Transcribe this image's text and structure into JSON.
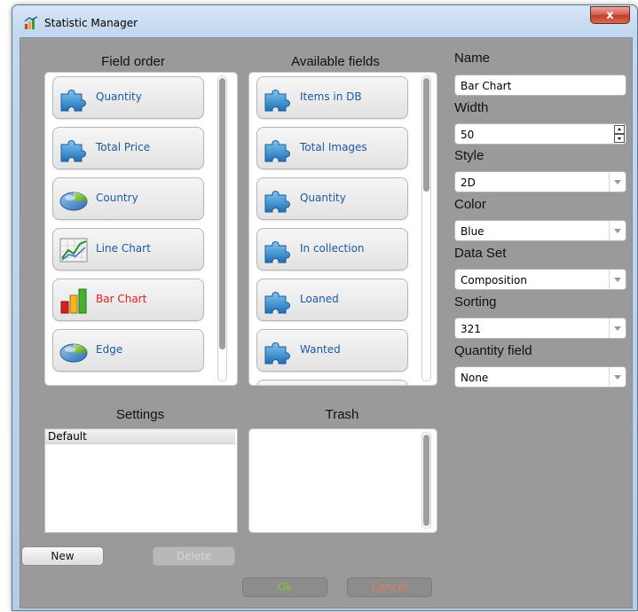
{
  "window": {
    "title": "Statistic Manager",
    "close_glyph": "x",
    "icon": "statistic-manager-app-icon"
  },
  "field_order": {
    "heading": "Field order",
    "items": [
      {
        "label": "Quantity",
        "icon": "puzzle-piece-icon"
      },
      {
        "label": "Total Price",
        "icon": "puzzle-piece-icon"
      },
      {
        "label": "Country",
        "icon": "pie-chart-icon"
      },
      {
        "label": "Line Chart",
        "icon": "line-chart-icon"
      },
      {
        "label": "Bar Chart",
        "icon": "bar-chart-icon",
        "selected": true
      },
      {
        "label": "Edge",
        "icon": "pie-chart-icon"
      }
    ]
  },
  "available_fields": {
    "heading": "Available fields",
    "items": [
      {
        "label": "Items in DB",
        "icon": "puzzle-piece-icon"
      },
      {
        "label": "Total Images",
        "icon": "puzzle-piece-icon"
      },
      {
        "label": "Quantity",
        "icon": "puzzle-piece-icon"
      },
      {
        "label": "In collection",
        "icon": "puzzle-piece-icon"
      },
      {
        "label": "Loaned",
        "icon": "puzzle-piece-icon"
      },
      {
        "label": "Wanted",
        "icon": "puzzle-piece-icon"
      }
    ]
  },
  "properties": {
    "name_label": "Name",
    "name_value": "Bar Chart",
    "width_label": "Width",
    "width_value": "50",
    "style_label": "Style",
    "style_value": "2D",
    "color_label": "Color",
    "color_value": "Blue",
    "dataset_label": "Data Set",
    "dataset_value": "Composition",
    "sorting_label": "Sorting",
    "sorting_value": "321",
    "quantity_label": "Quantity field",
    "quantity_value": "None"
  },
  "settings": {
    "heading": "Settings",
    "items": [
      "Default"
    ],
    "new_label": "New",
    "delete_label": "Delete"
  },
  "trash": {
    "heading": "Trash"
  },
  "footer": {
    "ok_label": "Ok",
    "cancel_label": "Cancel"
  },
  "colors": {
    "accent_text": "#1a5aa8",
    "selected_text": "#e02020",
    "client_background": "#9a9a9a",
    "ok_text": "#7ec832",
    "cancel_text": "#e08060"
  }
}
